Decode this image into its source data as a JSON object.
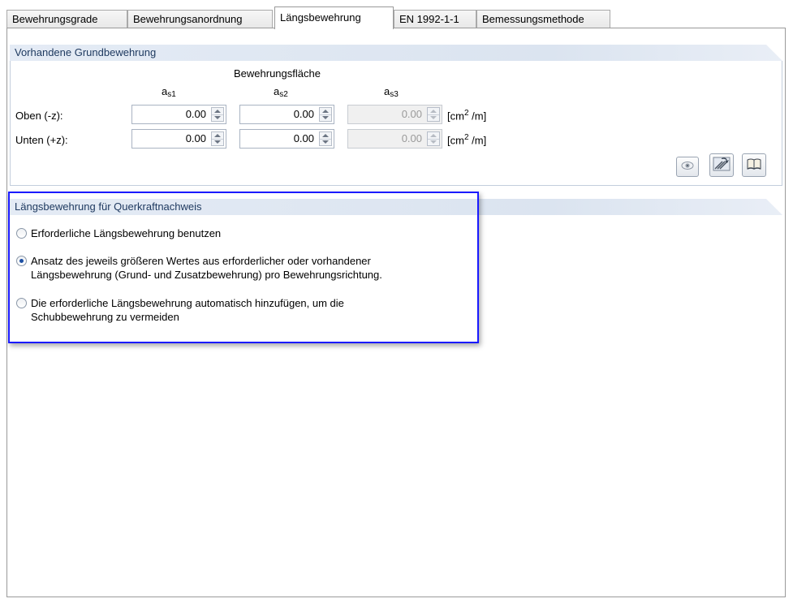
{
  "tabs": [
    {
      "label": "Bewehrungsgrade"
    },
    {
      "label": "Bewehrungsanordnung"
    },
    {
      "label": "Längsbewehrung"
    },
    {
      "label": "EN 1992-1-1"
    },
    {
      "label": "Bemessungsmethode"
    }
  ],
  "grund": {
    "header": "Vorhandene Grundbewehrung",
    "area_label": "Bewehrungsfläche",
    "columns": [
      {
        "base": "a",
        "sub": "s1"
      },
      {
        "base": "a",
        "sub": "s2"
      },
      {
        "base": "a",
        "sub": "s3"
      }
    ],
    "rows": [
      {
        "label": "Oben (-z):",
        "values": [
          "0.00",
          "0.00",
          "0.00"
        ]
      },
      {
        "label": "Unten (+z):",
        "values": [
          "0.00",
          "0.00",
          "0.00"
        ]
      }
    ],
    "unit_prefix": "[cm",
    "unit_sup": "2",
    "unit_suffix": " /m]"
  },
  "quer": {
    "header": "Längsbewehrung für Querkraftnachweis",
    "options": [
      {
        "line1": "Erforderliche Längsbewehrung benutzen",
        "line2": "",
        "checked": false
      },
      {
        "line1": "Ansatz des jeweils größeren Wertes aus erforderlicher oder vorhandener",
        "line2": "Längsbewehrung (Grund- und Zusatzbewehrung) pro Bewehrungsrichtung.",
        "checked": true
      },
      {
        "line1": "Die erforderliche Längsbewehrung automatisch hinzufügen, um die",
        "line2": "Schubbewehrung zu vermeiden",
        "checked": false
      }
    ]
  },
  "icons": [
    "eye-icon",
    "rebar-import-icon",
    "book-icon"
  ],
  "colors": {
    "highlight": "#1a1aff",
    "header_bg": "#e4ebf5",
    "header_text": "#1f3a60",
    "radio_dot": "#1d4fa3"
  }
}
